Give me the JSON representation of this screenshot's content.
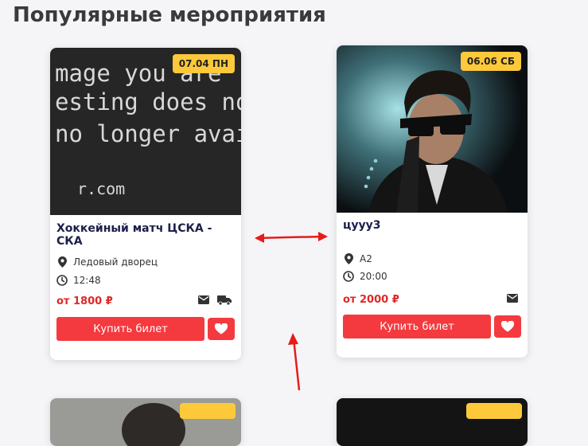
{
  "section": {
    "title": "Популярные мероприятия"
  },
  "events": [
    {
      "date": "07.04 ПН",
      "title": "Хоккейный матч ЦСКА - СКА",
      "venue": "Ледовый дворец",
      "time": "12:48",
      "price": "от 1800 ₽",
      "buy_label": "Купить билет",
      "image_text": [
        "mage you are",
        "esting does not",
        "no longer availa",
        "r.com"
      ],
      "features": [
        "envelope-icon",
        "truck-icon"
      ]
    },
    {
      "date": "06.06 СБ",
      "title": "цууу3",
      "venue": "А2",
      "time": "20:00",
      "price": "от 2000 ₽",
      "buy_label": "Купить билет",
      "features": [
        "envelope-icon"
      ]
    }
  ],
  "colors": {
    "accent": "#f43a3f",
    "badge": "#fdc93a",
    "price": "#e02727",
    "title": "#1c1f4a"
  }
}
